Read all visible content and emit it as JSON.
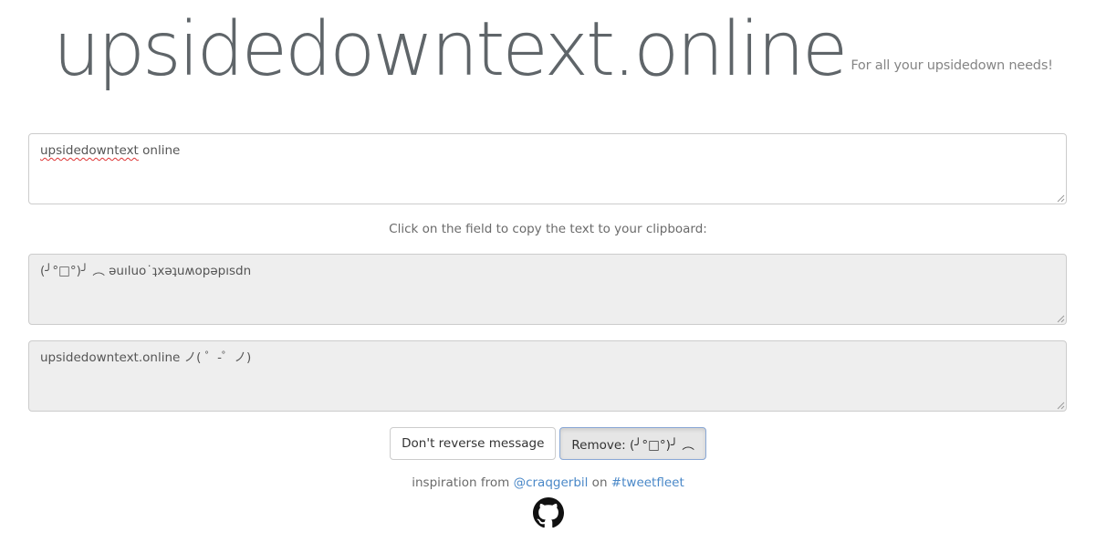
{
  "header": {
    "site_title": "upsidedowntext.online",
    "tagline": "For all your upsidedown needs!"
  },
  "input": {
    "value_word1": "upsidedowntext",
    "value_rest": " online"
  },
  "copy_hint": "Click on the field to copy the text to your clipboard:",
  "outputs": {
    "flipped": "(╯°□°)╯ ︵ ǝuıluo˙ʇxǝʇuʍopǝpısdn",
    "restored": "upsidedowntext.online ノ( ゜-゜ノ)"
  },
  "buttons": {
    "reverse_label": "Don't reverse message",
    "remove_label": "Remove: (╯°□°)╯ ︵"
  },
  "credit": {
    "prefix": "inspiration from ",
    "user_link": "@craqgerbil",
    "middle": " on ",
    "tag_link": "#tweetfleet"
  },
  "icons": {
    "github": "github-icon",
    "resize": "resize-grip-icon"
  },
  "colors": {
    "title": "#5f6569",
    "link": "#4a88c8",
    "readonly_bg": "#eeeeee",
    "active_border": "#8aa8d6"
  }
}
